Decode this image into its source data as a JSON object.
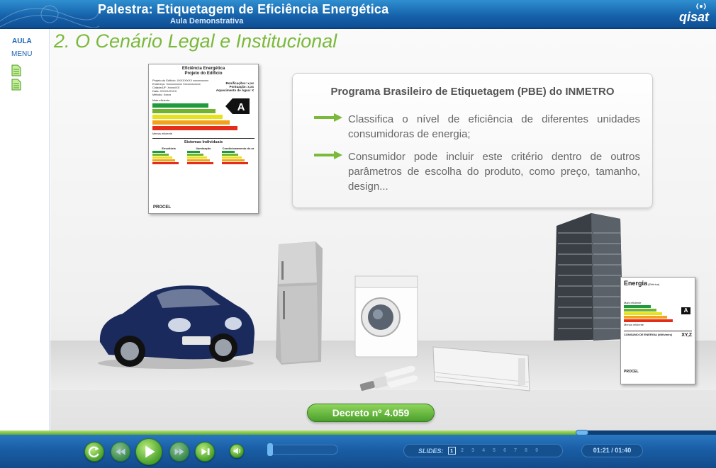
{
  "header": {
    "title": "Palestra: Etiquetagem de Eficiência Energética",
    "subtitle": "Aula Demonstrativa",
    "brand": "qisat"
  },
  "leftnav": {
    "aula": "AULA",
    "menu": "MENU",
    "docs": [
      "document-icon",
      "document-icon"
    ]
  },
  "slide": {
    "title": "2. O Cenário Legal e Institucional",
    "infobox": {
      "heading": "Programa Brasileiro de Etiquetagem (PBE) do INMETRO",
      "bullets": [
        "Classifica o nível de eficiência de diferentes unidades consumidoras de energia;",
        "Consumidor pode incluir este critério dentro de outros parâmetros de escolha do produto, como preço, tamanho, design..."
      ]
    },
    "decree_button": "Decreto nº 4.059",
    "building_label": {
      "title": "Eficiência Energética",
      "subtitle": "Projeto do Edifício",
      "rows": [
        "Projeto do Edifício: XXXXXXXX xxxxxxxxxxx",
        "Endereço: Xxxxxxxxxxx Xxxxxxxxxxxx",
        "Cidade/UF: Xxxxx/XX",
        "Data: XX/XX/XXXX",
        "Método: Xxxxx"
      ],
      "bonus": "Bonificações: x,xx",
      "score": "Pontuação: x,xx",
      "heating": "Aquecimento de Água: X",
      "grade": "A",
      "most_efficient": "Mais eficiente",
      "least_efficient": "Menos eficiente",
      "systems_title": "Sistemas Individuais",
      "systems": [
        "Envoltória",
        "Iluminação",
        "Condicionamento do ar"
      ],
      "footer": "PROCEL"
    },
    "appliance_label": {
      "title": "Energia",
      "subtitle": "(Elétrica)",
      "most_efficient": "Mais eficiente",
      "least_efficient": "Menos eficiente",
      "grade": "A",
      "consumption": "CONSUMO DE ENERGIA (kWh/mês)",
      "value": "XY,Z",
      "footer": "PROCEL"
    },
    "illustrations": [
      "car",
      "refrigerator",
      "washing-machine",
      "lamp",
      "air-conditioner",
      "building"
    ]
  },
  "player": {
    "slides_label": "SLIDES:",
    "slides": [
      "1",
      "2",
      "3",
      "4",
      "5",
      "6",
      "7",
      "8",
      "9"
    ],
    "current_slide": "1",
    "time": "01:21 / 01:40",
    "progress": 0.82,
    "volume": 0.0
  },
  "colors": {
    "header": "#1560a8",
    "accent_green": "#7ab93a",
    "text_grey": "#666666",
    "nav_blue": "#1a63b5",
    "energy_bars": [
      "#1f9a3c",
      "#71b32f",
      "#e8e21b",
      "#f3a21d",
      "#e52d1c"
    ]
  }
}
